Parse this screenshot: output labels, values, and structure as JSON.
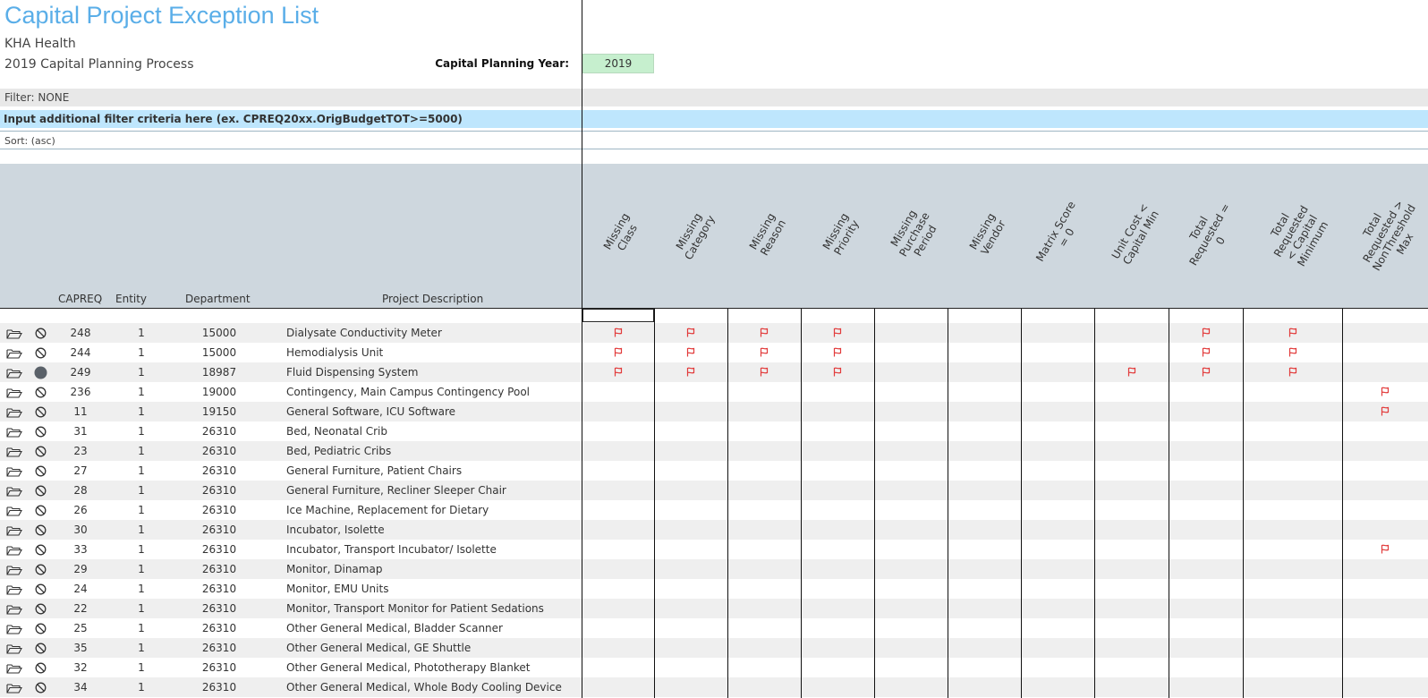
{
  "header": {
    "title": "Capital Project Exception List",
    "org": "KHA Health",
    "process": "2019 Capital Planning Process",
    "capital_year_label": "Capital Planning Year:",
    "capital_year_value": "2019"
  },
  "filter": {
    "label": "Filter: NONE",
    "input_hint": "Input additional filter criteria here (ex. CPREQ20xx.OrigBudgetTOT>=5000)",
    "sort": "Sort:  (asc)"
  },
  "colors": {
    "title": "#5aaee8",
    "flag": "#e23b3b",
    "header_bg": "#ced7de",
    "input_bar": "#bee6fd",
    "year_cell": "#c6efce"
  },
  "columns": {
    "capreq": "CAPREQ",
    "entity": "Entity",
    "department": "Department",
    "description": "Project Description",
    "exceptions": [
      "Missing\nClass",
      "Missing\nCategory",
      "Missing\nReason",
      "Missing\nPriority",
      "Missing\nPurchase\nPeriod",
      "Missing\nVendor",
      "Matrix Score\n= 0",
      "Unit Cost <\nCapital Min",
      "Total\nRequested =\n0",
      "Total Requested\n< Capital\nMinimum",
      "Total Requested >\nNonThreshold\nMax"
    ]
  },
  "icons": {
    "open": "folder-open-icon",
    "status_none": "prohibited-icon",
    "status_filled": "filled-circle-icon"
  },
  "rows": [
    {
      "capreq": "248",
      "entity": "1",
      "department": "15000",
      "description": "Dialysate Conductivity Meter",
      "status": "none",
      "flags": [
        0,
        1,
        2,
        3,
        8,
        9
      ]
    },
    {
      "capreq": "244",
      "entity": "1",
      "department": "15000",
      "description": "Hemodialysis Unit",
      "status": "none",
      "flags": [
        0,
        1,
        2,
        3,
        8,
        9
      ]
    },
    {
      "capreq": "249",
      "entity": "1",
      "department": "18987",
      "description": "Fluid Dispensing System",
      "status": "filled",
      "flags": [
        0,
        1,
        2,
        3,
        7,
        8,
        9
      ]
    },
    {
      "capreq": "236",
      "entity": "1",
      "department": "19000",
      "description": "Contingency, Main Campus Contingency Pool",
      "status": "none",
      "flags": [
        10
      ]
    },
    {
      "capreq": "11",
      "entity": "1",
      "department": "19150",
      "description": "General Software, ICU Software",
      "status": "none",
      "flags": [
        10
      ]
    },
    {
      "capreq": "31",
      "entity": "1",
      "department": "26310",
      "description": "Bed, Neonatal Crib",
      "status": "none",
      "flags": []
    },
    {
      "capreq": "23",
      "entity": "1",
      "department": "26310",
      "description": "Bed, Pediatric Cribs",
      "status": "none",
      "flags": []
    },
    {
      "capreq": "27",
      "entity": "1",
      "department": "26310",
      "description": "General Furniture, Patient Chairs",
      "status": "none",
      "flags": []
    },
    {
      "capreq": "28",
      "entity": "1",
      "department": "26310",
      "description": "General Furniture, Recliner Sleeper Chair",
      "status": "none",
      "flags": []
    },
    {
      "capreq": "26",
      "entity": "1",
      "department": "26310",
      "description": "Ice Machine, Replacement for Dietary",
      "status": "none",
      "flags": []
    },
    {
      "capreq": "30",
      "entity": "1",
      "department": "26310",
      "description": "Incubator, Isolette",
      "status": "none",
      "flags": []
    },
    {
      "capreq": "33",
      "entity": "1",
      "department": "26310",
      "description": "Incubator, Transport Incubator/ Isolette",
      "status": "none",
      "flags": [
        10
      ]
    },
    {
      "capreq": "29",
      "entity": "1",
      "department": "26310",
      "description": "Monitor, Dinamap",
      "status": "none",
      "flags": []
    },
    {
      "capreq": "24",
      "entity": "1",
      "department": "26310",
      "description": "Monitor, EMU Units",
      "status": "none",
      "flags": []
    },
    {
      "capreq": "22",
      "entity": "1",
      "department": "26310",
      "description": "Monitor, Transport Monitor for Patient Sedations",
      "status": "none",
      "flags": []
    },
    {
      "capreq": "25",
      "entity": "1",
      "department": "26310",
      "description": "Other General Medical, Bladder Scanner",
      "status": "none",
      "flags": []
    },
    {
      "capreq": "35",
      "entity": "1",
      "department": "26310",
      "description": "Other General Medical, GE Shuttle",
      "status": "none",
      "flags": []
    },
    {
      "capreq": "32",
      "entity": "1",
      "department": "26310",
      "description": "Other General Medical, Phototherapy Blanket",
      "status": "none",
      "flags": []
    },
    {
      "capreq": "34",
      "entity": "1",
      "department": "26310",
      "description": "Other General Medical, Whole Body Cooling Device",
      "status": "none",
      "flags": []
    }
  ]
}
